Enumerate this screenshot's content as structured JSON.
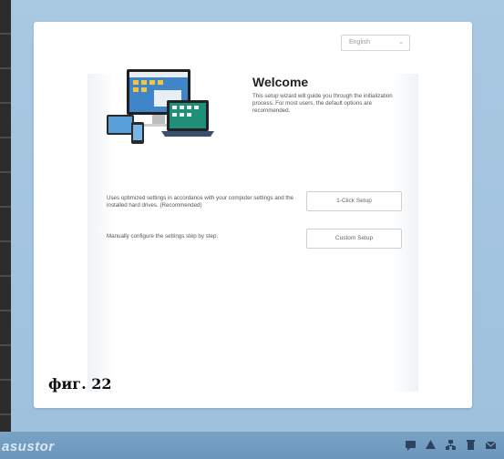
{
  "wizard": {
    "language": "English",
    "title": "Welcome",
    "description": "This setup wizard will guide you through the initialization process. For most users, the default options are recommended.",
    "option_one_text": "Uses optimized settings in accordance with your computer settings and the installed hard drives. (Recommended)",
    "option_one_button": "1-Click Setup",
    "option_two_text": "Manually configure the settings step by step.",
    "option_two_button": "Custom Setup"
  },
  "caption": "фиг. 22",
  "taskbar": {
    "brand": "asustor",
    "icons": [
      "chat-icon",
      "cloud-icon",
      "network-icon",
      "trash-icon",
      "mail-icon"
    ]
  },
  "colors": {
    "backdrop": "#a9c8e2",
    "taskbar": "#6b96bb",
    "panel": "#ffffff"
  }
}
